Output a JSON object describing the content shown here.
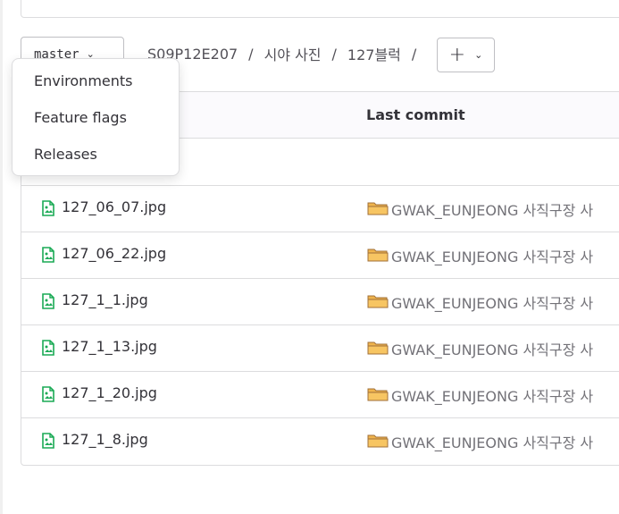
{
  "branch": {
    "name": "master"
  },
  "breadcrumb": {
    "parts": [
      "S09P12E207",
      "시야 사진",
      "127블럭"
    ],
    "separator": "/"
  },
  "add_button": {
    "plus": "+"
  },
  "table": {
    "header": {
      "last_commit": "Last commit"
    },
    "files": [
      {
        "name": "127_06_07.jpg",
        "commit": "GWAK_EUNJEONG 사직구장 사"
      },
      {
        "name": "127_06_22.jpg",
        "commit": "GWAK_EUNJEONG 사직구장 사"
      },
      {
        "name": "127_1_1.jpg",
        "commit": "GWAK_EUNJEONG 사직구장 사"
      },
      {
        "name": "127_1_13.jpg",
        "commit": "GWAK_EUNJEONG 사직구장 사"
      },
      {
        "name": "127_1_20.jpg",
        "commit": "GWAK_EUNJEONG 사직구장 사"
      },
      {
        "name": "127_1_8.jpg",
        "commit": "GWAK_EUNJEONG 사직구장 사"
      }
    ]
  },
  "dropdown": {
    "items": [
      "Environments",
      "Feature flags",
      "Releases"
    ]
  },
  "colors": {
    "file_icon": "#1aaa55",
    "folder_icon": "#e8a33d"
  },
  "icons": {
    "file": "image-file-icon",
    "folder": "folder-emoji-icon",
    "chevron": "chevron-down-icon"
  }
}
